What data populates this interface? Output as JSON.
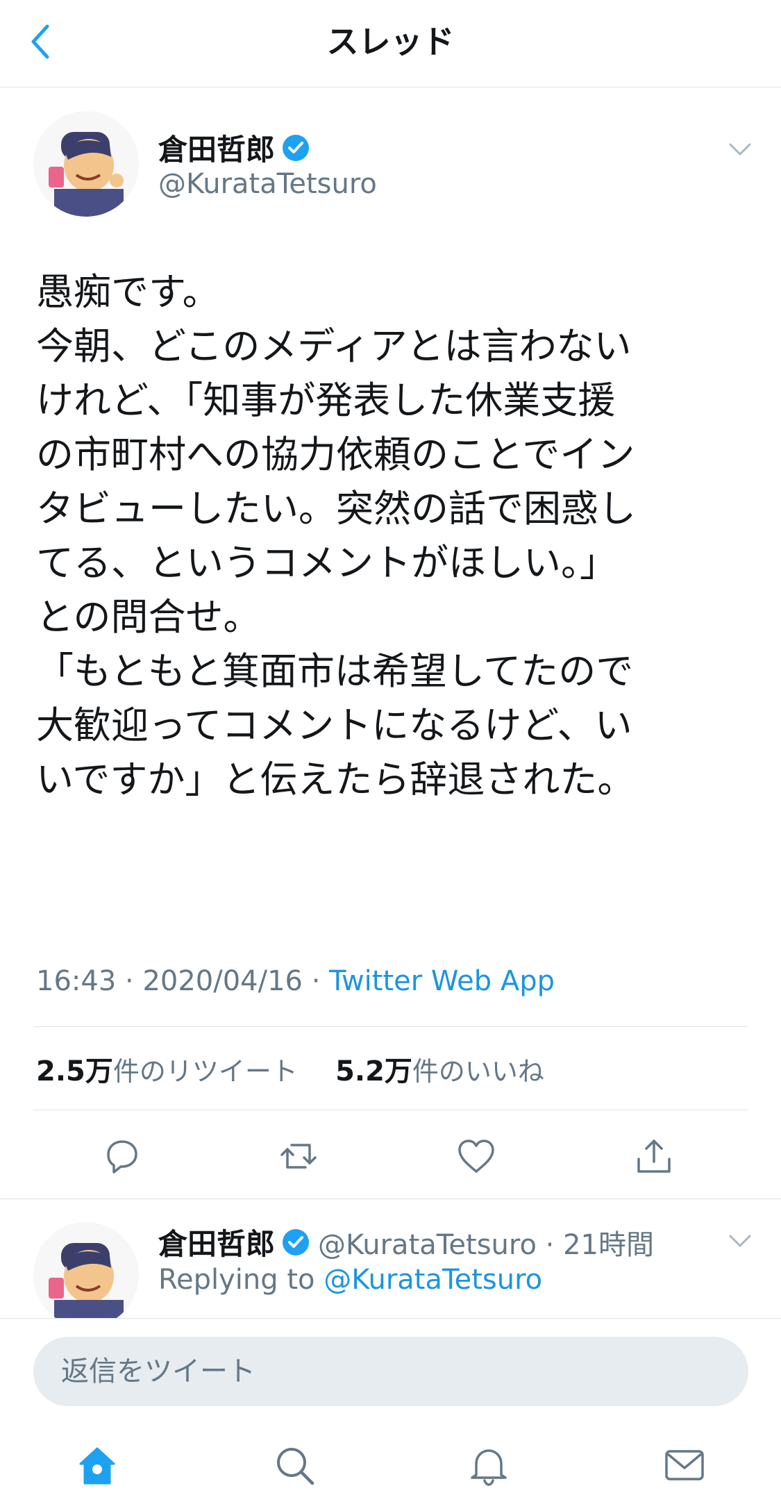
{
  "header": {
    "title": "スレッド"
  },
  "tweet": {
    "display_name": "倉田哲郎",
    "handle": "@KurataTetsuro",
    "text": "愚痴です。\n今朝、どこのメディアとは言わない\nけれど、「知事が発表した休業支援\nの市町村への協力依頼のことでイン\nタビューしたい。突然の話で困惑し\nてる、というコメントがほしい。」\nとの問合せ。\n「もともと箕面市は希望してたので\n大歓迎ってコメントになるけど、い\nいですか」と伝えたら辞退された。",
    "time": "16:43",
    "date": "2020/04/16",
    "source": "Twitter Web App",
    "retweets_count": "2.5万",
    "retweets_label": "件のリツイート",
    "likes_count": "5.2万",
    "likes_label": "件のいいね"
  },
  "reply": {
    "display_name": "倉田哲郎",
    "handle_time": "@KurataTetsuro · 21時間",
    "replying_prefix": "Replying to",
    "replying_to": "@KurataTetsuro"
  },
  "composer": {
    "placeholder": "返信をツイート"
  },
  "icons": {
    "back": "chevron-left-icon",
    "verified": "verified-badge-icon",
    "caret": "chevron-down-icon",
    "actions": [
      "reply-icon",
      "retweet-icon",
      "like-icon",
      "share-icon"
    ],
    "tabs": [
      "home-icon",
      "search-icon",
      "notifications-icon",
      "messages-icon"
    ]
  },
  "colors": {
    "accent": "#1da1f2",
    "muted": "#657786",
    "divider": "#dfe3e6"
  }
}
